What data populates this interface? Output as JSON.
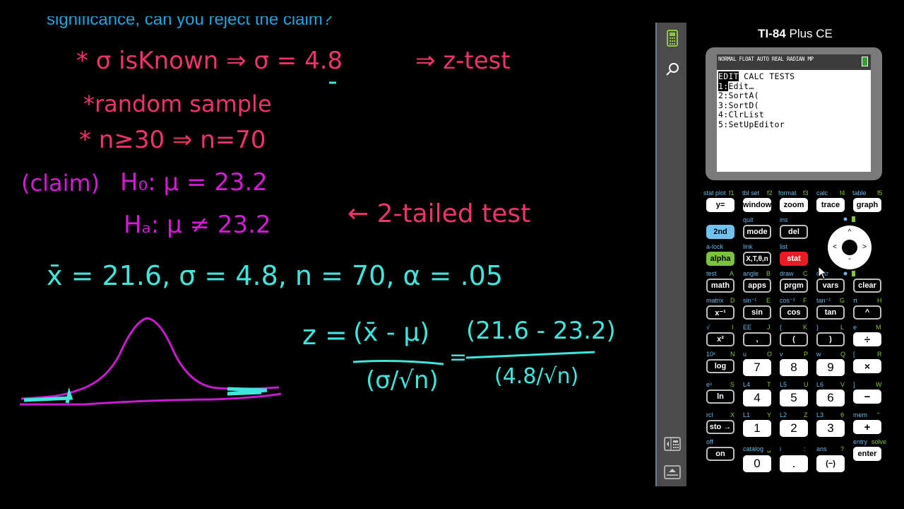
{
  "board": {
    "prompt_fragment": "significance, can you reject the claim?",
    "lines": {
      "condition1_left": "* σ isKnown ⇒ σ = 4.8",
      "condition1_right": "⇒ z-test",
      "condition2": "*random sample",
      "condition3": "* n≥30 ⇒ n=70",
      "claim_label": "(claim)",
      "h0": "H₀: μ = 23.2",
      "ha": "Hₐ: μ ≠ 23.2",
      "tail_note": "← 2-tailed test",
      "givens": "x̄ = 21.6,  σ = 4.8,  n = 70,  α = .05",
      "z_label": "z =",
      "z_num": "(x̄ - μ)",
      "z_den": "(σ/√n)",
      "eq": "=",
      "sub_num": "(21.6 - 23.2)",
      "sub_den": "(4.8/√n)"
    },
    "colors": {
      "pink": "#f0336a",
      "magenta": "#d41ad6",
      "cyan": "#3fe6dc",
      "prompt_blue": "#1fa5e0"
    }
  },
  "sidebar": {
    "items": [
      {
        "icon": "calculator-icon",
        "active": true
      },
      {
        "icon": "search-icon"
      },
      {
        "icon": "keypad-layout-icon"
      },
      {
        "icon": "screen-capture-icon"
      }
    ]
  },
  "calculator": {
    "model_bold": "TI-84",
    "model_rest": " Plus CE",
    "status_bar": "NORMAL FLOAT AUTO REAL RADIAN MP",
    "menu_tabs": [
      "EDIT",
      "CALC",
      "TESTS"
    ],
    "menu_active_tab": "EDIT",
    "menu_items": [
      {
        "num": "1:",
        "label": "Edit…"
      },
      {
        "num": "2:",
        "label": "SortA("
      },
      {
        "num": "3:",
        "label": "SortD("
      },
      {
        "num": "4:",
        "label": "ClrList"
      },
      {
        "num": "5:",
        "label": "SetUpEditor"
      }
    ],
    "keys": {
      "y": {
        "label": "y=",
        "second": "stat plot",
        "alpha": "f1"
      },
      "window": {
        "label": "window",
        "second": "tbl set",
        "alpha": "f2"
      },
      "zoom": {
        "label": "zoom",
        "second": "format",
        "alpha": "f3"
      },
      "trace": {
        "label": "trace",
        "second": "calc",
        "alpha": "f4"
      },
      "graph": {
        "label": "graph",
        "second": "table",
        "alpha": "f5"
      },
      "second": {
        "label": "2nd"
      },
      "mode": {
        "label": "mode",
        "second": "quit"
      },
      "del": {
        "label": "del",
        "second": "ins"
      },
      "alpha": {
        "label": "alpha",
        "second": "a-lock"
      },
      "xt": {
        "label": "X,T,θ,n",
        "second": "link"
      },
      "stat": {
        "label": "stat",
        "second": "list"
      },
      "math": {
        "label": "math",
        "second": "test",
        "alpha": "A"
      },
      "apps": {
        "label": "apps",
        "second": "angle",
        "alpha": "B"
      },
      "prgm": {
        "label": "prgm",
        "second": "draw",
        "alpha": "C"
      },
      "vars": {
        "label": "vars",
        "second": "distr"
      },
      "clear": {
        "label": "clear"
      },
      "inv": {
        "label": "x⁻¹",
        "second": "matrix",
        "alpha": "D"
      },
      "sin": {
        "label": "sin",
        "second": "sin⁻¹",
        "alpha": "E"
      },
      "cos": {
        "label": "cos",
        "second": "cos⁻¹",
        "alpha": "F"
      },
      "tan": {
        "label": "tan",
        "second": "tan⁻¹",
        "alpha": "G"
      },
      "pow": {
        "label": "^",
        "second": "π",
        "alpha": "H"
      },
      "sq": {
        "label": "x²",
        "second": "√",
        "alpha": "I"
      },
      "comma": {
        "label": ",",
        "second": "EE",
        "alpha": "J"
      },
      "lparen": {
        "label": "(",
        "second": "{",
        "alpha": "K"
      },
      "rparen": {
        "label": ")",
        "second": "}",
        "alpha": "L"
      },
      "div": {
        "label": "÷",
        "second": "e",
        "alpha": "M"
      },
      "log": {
        "label": "log",
        "second": "10ˣ",
        "alpha": "N"
      },
      "k7": {
        "label": "7",
        "second": "u",
        "alpha": "O"
      },
      "k8": {
        "label": "8",
        "second": "v",
        "alpha": "P"
      },
      "k9": {
        "label": "9",
        "second": "w",
        "alpha": "Q"
      },
      "mul": {
        "label": "×",
        "second": "[",
        "alpha": "R"
      },
      "ln": {
        "label": "ln",
        "second": "eˣ",
        "alpha": "S"
      },
      "k4": {
        "label": "4",
        "second": "L4",
        "alpha": "T"
      },
      "k5": {
        "label": "5",
        "second": "L5",
        "alpha": "U"
      },
      "k6": {
        "label": "6",
        "second": "L6",
        "alpha": "V"
      },
      "sub": {
        "label": "−",
        "second": "]",
        "alpha": "W"
      },
      "sto": {
        "label": "sto →",
        "second": "rcl",
        "alpha": "X"
      },
      "k1": {
        "label": "1",
        "second": "L1",
        "alpha": "Y"
      },
      "k2": {
        "label": "2",
        "second": "L2",
        "alpha": "Z"
      },
      "k3": {
        "label": "3",
        "second": "L3",
        "alpha": "θ"
      },
      "add": {
        "label": "+",
        "second": "mem",
        "alpha": "\""
      },
      "on": {
        "label": "on",
        "second": "off"
      },
      "k0": {
        "label": "0",
        "second": "catalog",
        "alpha": "␣"
      },
      "dot": {
        "label": ".",
        "second": "i",
        "alpha": ":"
      },
      "neg": {
        "label": "(−)",
        "second": "ans",
        "alpha": "?"
      },
      "enter": {
        "label": "enter",
        "second": "entry",
        "alpha": "solve"
      }
    },
    "dpad": {
      "up": "^",
      "down": "ˇ",
      "left": "<",
      "right": ">"
    }
  }
}
